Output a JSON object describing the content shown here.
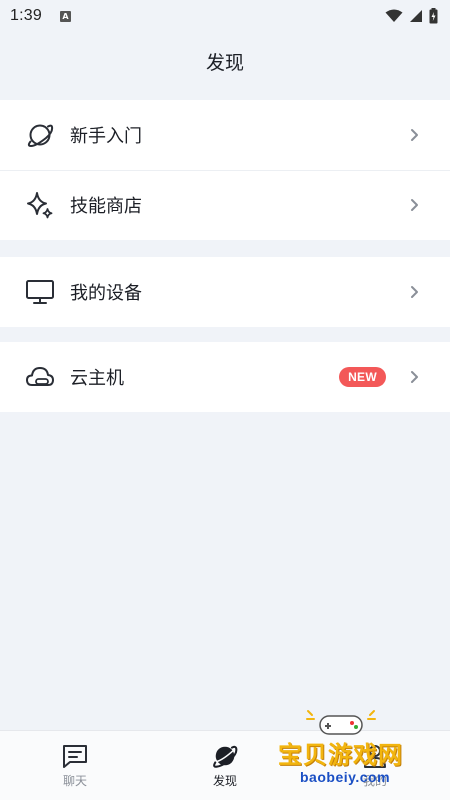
{
  "status_bar": {
    "time": "1:39",
    "notification_letter": "A"
  },
  "header": {
    "title": "发现"
  },
  "sections": [
    {
      "items": [
        {
          "label": "新手入门",
          "icon": "planet-icon"
        },
        {
          "label": "技能商店",
          "icon": "sparkle-icon"
        }
      ]
    },
    {
      "items": [
        {
          "label": "我的设备",
          "icon": "monitor-icon"
        }
      ]
    },
    {
      "items": [
        {
          "label": "云主机",
          "icon": "cloud-icon",
          "badge": "NEW"
        }
      ]
    }
  ],
  "bottom_nav": {
    "items": [
      {
        "label": "聊天",
        "icon": "chat-icon",
        "active": false
      },
      {
        "label": "发现",
        "icon": "planet-icon",
        "active": true
      },
      {
        "label": "我的",
        "icon": "person-icon",
        "active": false
      }
    ]
  },
  "watermark": {
    "text": "宝贝游戏网",
    "url": "baobeiy.com"
  },
  "colors": {
    "background": "#f0f3f8",
    "badge": "#f35858",
    "text": "#1c1f26"
  }
}
